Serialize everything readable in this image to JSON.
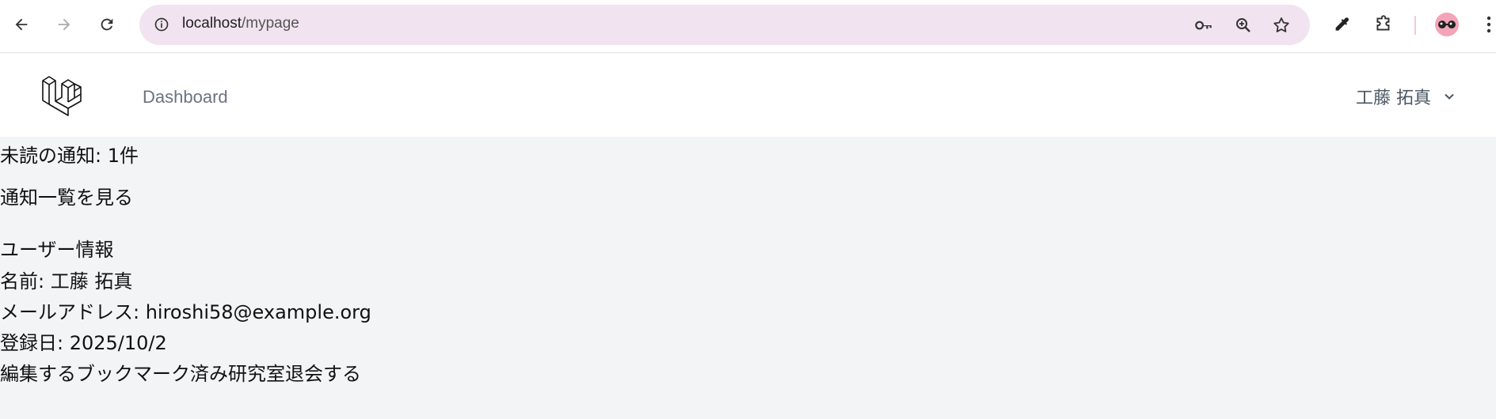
{
  "browser": {
    "url_host": "localhost",
    "url_path": "/mypage"
  },
  "app": {
    "nav": {
      "dashboard_label": "Dashboard"
    },
    "user": {
      "name": "工藤 拓真"
    }
  },
  "content": {
    "unread_notifications": "未読の通知: 1件",
    "view_notifications_link": "通知一覧を見る",
    "user_info_heading": "ユーザー情報",
    "name_line": "名前: 工藤 拓真",
    "email_line": "メールアドレス: hiroshi58@example.org",
    "registered_line": "登録日: 2025/10/2",
    "actions": {
      "edit": "編集する",
      "bookmarks": "ブックマーク済み研究室",
      "withdraw": "退会する"
    }
  }
}
